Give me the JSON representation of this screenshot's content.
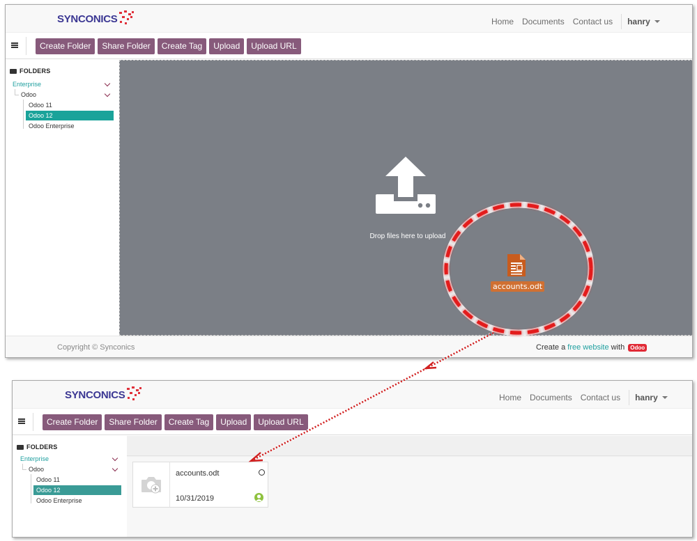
{
  "brand": {
    "logo_text": "SYNCONICS",
    "logo_color": "#3b3793",
    "accent": "#e0303a"
  },
  "nav": {
    "home": "Home",
    "documents": "Documents",
    "contact": "Contact us",
    "user": "hanry"
  },
  "toolbar": {
    "create_folder": "Create Folder",
    "share_folder": "Share Folder",
    "create_tag": "Create Tag",
    "upload": "Upload",
    "upload_url": "Upload URL",
    "button_color": "#875a7b"
  },
  "sidebar": {
    "heading": "FOLDERS",
    "items": [
      {
        "label": "Enterprise"
      },
      {
        "label": "Odoo"
      },
      {
        "label": "Odoo 11"
      },
      {
        "label": "Odoo 12"
      },
      {
        "label": "Odoo Enterprise"
      }
    ],
    "selected_color": "#1aa39a"
  },
  "dropzone": {
    "label": "Drop files here to upload",
    "dragged_file": "accounts.odt"
  },
  "footer": {
    "copyright": "Copyright © Synconics",
    "credit_prefix": "Create a",
    "credit_link": "free website",
    "credit_mid": "with",
    "badge": "Odoo"
  },
  "document_card": {
    "name": "accounts.odt",
    "date": "10/31/2019"
  },
  "icons": [
    "hamburger-icon",
    "folder-open-icon",
    "chevron-down-icon",
    "upload-icon",
    "odt-file-icon",
    "camera-plus-icon",
    "user-avatar-icon"
  ]
}
